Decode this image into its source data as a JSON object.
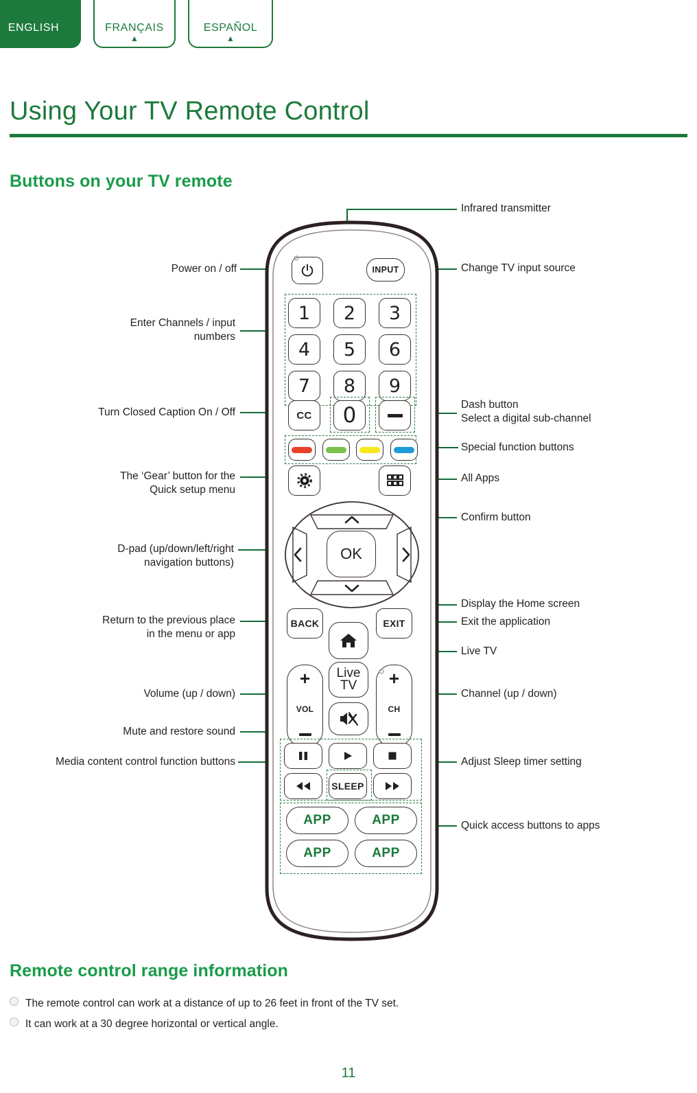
{
  "language_tabs": [
    {
      "label": "ENGLISH",
      "active": true,
      "caret": ""
    },
    {
      "label": "FRANÇAIS",
      "active": false,
      "caret": "▲"
    },
    {
      "label": "ESPAÑOL",
      "active": false,
      "caret": "▲"
    }
  ],
  "page": {
    "title": "Using Your TV Remote Control",
    "subhead": "Buttons on your TV remote",
    "range_head": "Remote control range information",
    "bullets": [
      "The remote control can work at a distance of up to 26 feet in front of the TV set.",
      "It can work at a 30 degree horizontal or vertical angle."
    ],
    "page_number": "11"
  },
  "callouts_left": [
    {
      "id": "power",
      "text": "Power on / off"
    },
    {
      "id": "numbers",
      "text": "Enter Channels / input\nnumbers"
    },
    {
      "id": "cc",
      "text": "Turn Closed Caption On / Off"
    },
    {
      "id": "gear",
      "text": "The ‘Gear’ button for the\nQuick setup menu"
    },
    {
      "id": "dpad",
      "text": "D-pad (up/down/left/right\nnavigation buttons)"
    },
    {
      "id": "back",
      "text": "Return to the previous place\nin the menu or app"
    },
    {
      "id": "vol",
      "text": "Volume (up / down)"
    },
    {
      "id": "mute",
      "text": "Mute and restore sound"
    },
    {
      "id": "media",
      "text": "Media content control function buttons"
    }
  ],
  "callouts_right": [
    {
      "id": "ir",
      "text": "Infrared transmitter"
    },
    {
      "id": "input",
      "text": "Change TV input source"
    },
    {
      "id": "dash",
      "text": "Dash button\nSelect a digital sub-channel"
    },
    {
      "id": "special",
      "text": "Special function buttons"
    },
    {
      "id": "allapps",
      "text": "All Apps"
    },
    {
      "id": "ok",
      "text": "Confirm button"
    },
    {
      "id": "home",
      "text": "Display the Home screen"
    },
    {
      "id": "exit",
      "text": "Exit the application"
    },
    {
      "id": "livetv",
      "text": "Live TV"
    },
    {
      "id": "ch",
      "text": "Channel (up / down)"
    },
    {
      "id": "sleep",
      "text": "Adjust Sleep timer setting"
    },
    {
      "id": "apps",
      "text": "Quick access buttons to apps"
    }
  ],
  "remote": {
    "power_icon": "power-icon",
    "input_label": "INPUT",
    "numbers": [
      "1",
      "2",
      "3",
      "4",
      "5",
      "6",
      "7",
      "8",
      "9"
    ],
    "cc_label": "CC",
    "zero_label": "0",
    "dash_label": "—",
    "color_buttons": [
      {
        "name": "red",
        "hex": "#e8412a"
      },
      {
        "name": "green",
        "hex": "#7cc14c"
      },
      {
        "name": "yellow",
        "hex": "#f6e81c"
      },
      {
        "name": "blue",
        "hex": "#1e9ad6"
      }
    ],
    "gear_icon": "gear-icon",
    "allapps_icon": "grid-apps-icon",
    "dpad": {
      "up": "⌃",
      "down": "⌄",
      "left": "‹",
      "right": "›",
      "center": "OK"
    },
    "back_label": "BACK",
    "exit_label": "EXIT",
    "home_icon": "home-icon",
    "livetv_label": "Live\nTV",
    "livetv_line1": "Live",
    "livetv_line2": "TV",
    "vol_label": "VOL",
    "ch_label": "CH",
    "plus": "+",
    "minus": "–",
    "mute_icon": "mute-icon",
    "media": [
      {
        "name": "pause-icon",
        "glyph": "❚❚"
      },
      {
        "name": "play-icon",
        "glyph": "▶"
      },
      {
        "name": "stop-icon",
        "glyph": "■"
      },
      {
        "name": "rewind-icon",
        "glyph": "◀◀"
      },
      {
        "name": "sleep-button",
        "glyph": "SLEEP"
      },
      {
        "name": "forward-icon",
        "glyph": "▶▶"
      }
    ],
    "app_buttons": [
      "APP",
      "APP",
      "APP",
      "APP"
    ]
  },
  "colors": {
    "brand_green": "#1b7a3b",
    "accent_green": "#1b9b4b",
    "line_green": "#146b38",
    "outline": "#3a3230",
    "text": "#231f20"
  }
}
